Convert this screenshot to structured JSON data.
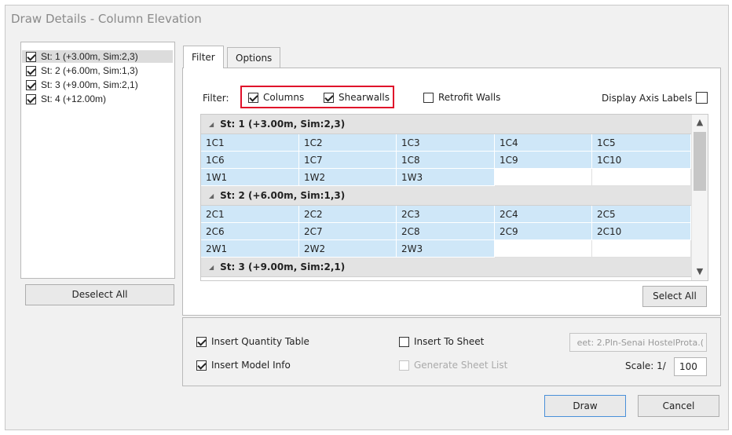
{
  "window": {
    "title": "Draw Details - Column Elevation"
  },
  "stories": [
    {
      "label": "St: 1 (+3.00m, Sim:2,3)",
      "checked": true,
      "selected": true
    },
    {
      "label": "St: 2 (+6.00m, Sim:1,3)",
      "checked": true,
      "selected": false
    },
    {
      "label": "St: 3 (+9.00m, Sim:2,1)",
      "checked": true,
      "selected": false
    },
    {
      "label": "St: 4 (+12.00m)",
      "checked": true,
      "selected": false
    }
  ],
  "deselect_all_label": "Deselect All",
  "tabs": [
    {
      "label": "Filter",
      "active": true
    },
    {
      "label": "Options",
      "active": false
    }
  ],
  "filter": {
    "label": "Filter:",
    "columns_label": "Columns",
    "columns_checked": true,
    "shearwalls_label": "Shearwalls",
    "shearwalls_checked": true,
    "retrofit_label": "Retrofit Walls",
    "retrofit_checked": false,
    "axis_labels_label": "Display Axis Labels",
    "axis_labels_checked": false
  },
  "grid": {
    "groups": [
      {
        "header": "St: 1 (+3.00m, Sim:2,3)",
        "rows": [
          [
            "1C1",
            "1C2",
            "1C3",
            "1C4",
            "1C5"
          ],
          [
            "1C6",
            "1C7",
            "1C8",
            "1C9",
            "1C10"
          ],
          [
            "1W1",
            "1W2",
            "1W3",
            "",
            ""
          ]
        ]
      },
      {
        "header": "St: 2 (+6.00m, Sim:1,3)",
        "rows": [
          [
            "2C1",
            "2C2",
            "2C3",
            "2C4",
            "2C5"
          ],
          [
            "2C6",
            "2C7",
            "2C8",
            "2C9",
            "2C10"
          ],
          [
            "2W1",
            "2W2",
            "2W3",
            "",
            ""
          ]
        ]
      },
      {
        "header": "St: 3 (+9.00m, Sim:2,1)",
        "rows": []
      }
    ]
  },
  "select_all_label": "Select All",
  "options": {
    "insert_quantity_table_label": "Insert Quantity Table",
    "insert_quantity_table_checked": true,
    "insert_model_info_label": "Insert Model Info",
    "insert_model_info_checked": true,
    "insert_to_sheet_label": "Insert To Sheet",
    "insert_to_sheet_checked": false,
    "generate_sheet_list_label": "Generate Sheet List",
    "generate_sheet_list_enabled": false,
    "sheet_field_value": "eet: 2.Pln-Senai HostelProta.(",
    "scale_label": "Scale: 1/",
    "scale_value": "100"
  },
  "draw_label": "Draw",
  "cancel_label": "Cancel",
  "colors": {
    "accent": "#4a90d9",
    "highlight": "#e0102a",
    "cell": "#cfe7f8"
  }
}
